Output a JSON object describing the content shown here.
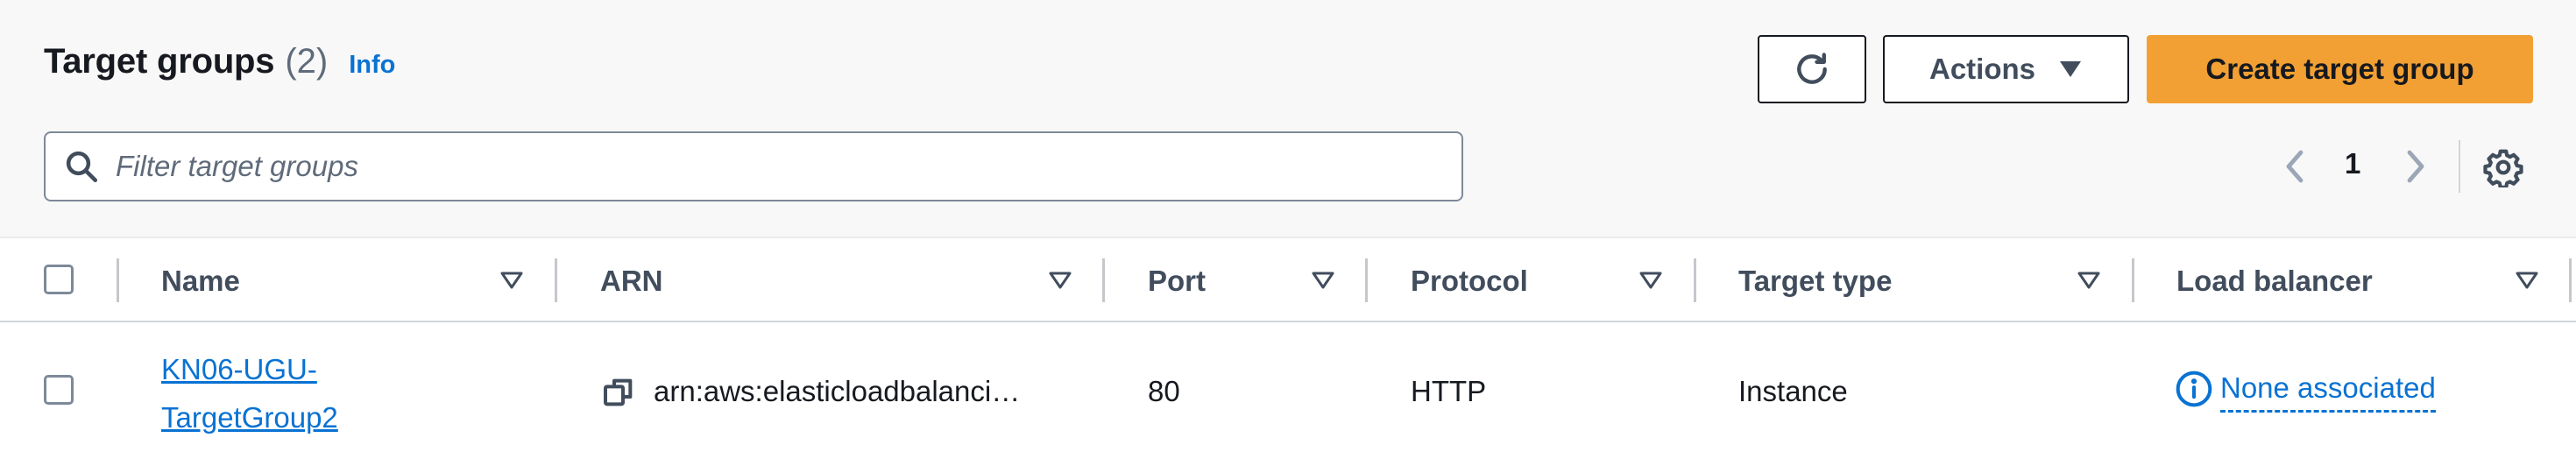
{
  "header": {
    "title": "Target groups",
    "count": "(2)",
    "info_label": "Info"
  },
  "toolbar": {
    "refresh_icon": "refresh-icon",
    "actions_label": "Actions",
    "create_label": "Create target group"
  },
  "search": {
    "placeholder": "Filter target groups",
    "value": ""
  },
  "pagination": {
    "current_page": "1"
  },
  "table": {
    "columns": [
      "Name",
      "ARN",
      "Port",
      "Protocol",
      "Target type",
      "Load balancer"
    ],
    "rows": [
      {
        "name": "KN06-UGU-TargetGroup2",
        "arn": "arn:aws:elasticloadbalanci…",
        "port": "80",
        "protocol": "HTTP",
        "target_type": "Instance",
        "load_balancer": "None associated"
      }
    ]
  },
  "colors": {
    "primary_button": "#f2a033",
    "link": "#0972d3",
    "text": "#16191f",
    "muted": "#5f6b7a"
  }
}
